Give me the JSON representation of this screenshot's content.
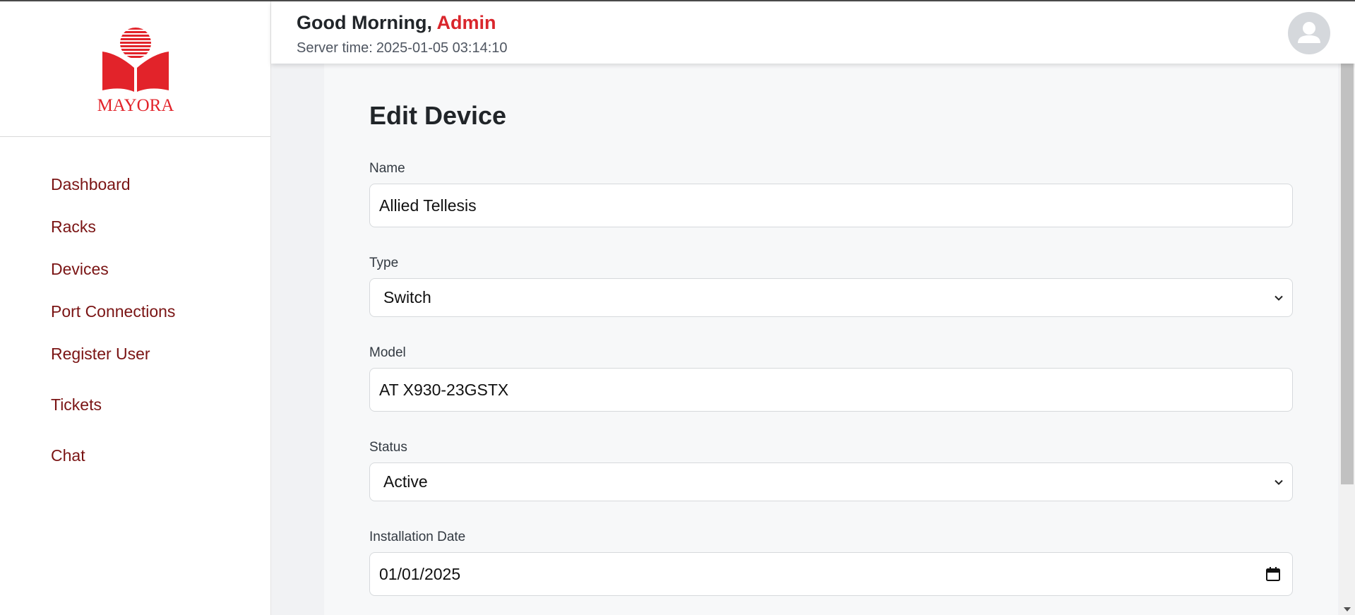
{
  "brand": {
    "logo_text": "MAYORA",
    "color": "#e2232a"
  },
  "sidebar": {
    "items": [
      {
        "label": "Dashboard"
      },
      {
        "label": "Racks"
      },
      {
        "label": "Devices"
      },
      {
        "label": "Port Connections"
      },
      {
        "label": "Register User"
      },
      {
        "label": "Tickets"
      },
      {
        "label": "Chat"
      }
    ]
  },
  "header": {
    "greeting": "Good Morning,",
    "user_name": "Admin",
    "server_time_label": "Server time:",
    "server_time_value": "2025-01-05 03:14:10",
    "avatar_icon": "user-avatar-icon"
  },
  "form": {
    "title": "Edit Device",
    "name": {
      "label": "Name",
      "value": "Allied Tellesis"
    },
    "type": {
      "label": "Type",
      "value": "Switch"
    },
    "model": {
      "label": "Model",
      "value": "AT X930-23GSTX"
    },
    "status": {
      "label": "Status",
      "value": "Active"
    },
    "installation_date": {
      "label": "Installation Date",
      "value": "01/01/2025"
    }
  },
  "colors": {
    "accent_red": "#d9262c",
    "nav_text": "#7a1414",
    "page_bg": "#f1f2f4"
  }
}
